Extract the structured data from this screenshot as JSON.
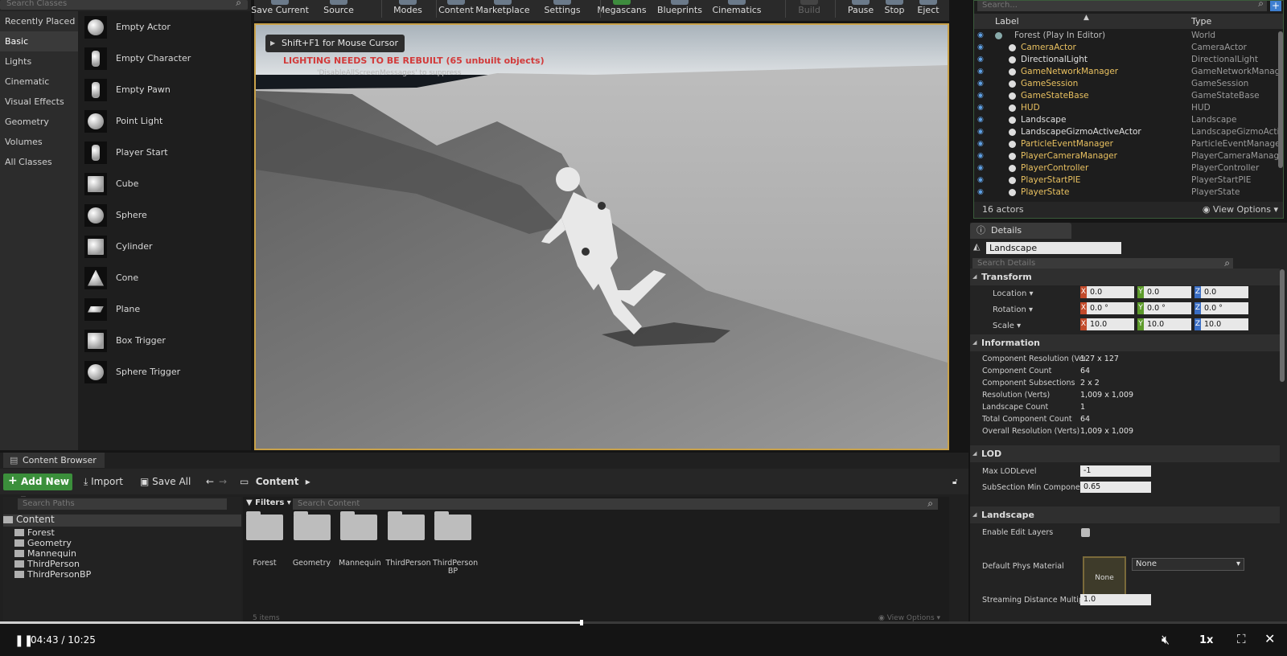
{
  "left_panel": {
    "search_placeholder": "Search Classes",
    "categories": [
      "Recently Placed",
      "Basic",
      "Lights",
      "Cinematic",
      "Visual Effects",
      "Geometry",
      "Volumes",
      "All Classes"
    ],
    "selected_category": "Basic",
    "classes": [
      {
        "label": "Empty Actor",
        "icon": "sphere-icon"
      },
      {
        "label": "Empty Character",
        "icon": "mannequin-icon"
      },
      {
        "label": "Empty Pawn",
        "icon": "pawn-icon"
      },
      {
        "label": "Point Light",
        "icon": "light-bulb-icon"
      },
      {
        "label": "Player Start",
        "icon": "player-start-icon"
      },
      {
        "label": "Cube",
        "icon": "cube-icon"
      },
      {
        "label": "Sphere",
        "icon": "sphere-icon"
      },
      {
        "label": "Cylinder",
        "icon": "cylinder-icon"
      },
      {
        "label": "Cone",
        "icon": "cone-icon"
      },
      {
        "label": "Plane",
        "icon": "plane-icon"
      },
      {
        "label": "Box Trigger",
        "icon": "box-trigger-icon"
      },
      {
        "label": "Sphere Trigger",
        "icon": "sphere-trigger-icon"
      }
    ]
  },
  "toolbar": {
    "buttons": [
      "Save Current",
      "Source Control",
      "Modes",
      "Content",
      "Marketplace",
      "Settings",
      "Megascans",
      "Blueprints",
      "Cinematics",
      "Build",
      "Pause",
      "Stop",
      "Eject"
    ]
  },
  "viewport": {
    "hint": "Shift+F1 for Mouse Cursor",
    "warning": "LIGHTING NEEDS TO BE REBUILT (65 unbuilt objects)",
    "dismiss": "'DisableAllScreenMessages' to suppress"
  },
  "outliner": {
    "search_placeholder": "Search...",
    "col_label": "Label",
    "col_type": "Type",
    "root": {
      "label": "Forest (Play In Editor)",
      "type": "World"
    },
    "rows": [
      {
        "label": "CameraActor",
        "type": "CameraActor",
        "highlight": true
      },
      {
        "label": "DirectionalLight",
        "type": "DirectionalLight",
        "highlight": false
      },
      {
        "label": "GameNetworkManager",
        "type": "GameNetworkManager",
        "highlight": true
      },
      {
        "label": "GameSession",
        "type": "GameSession",
        "highlight": true
      },
      {
        "label": "GameStateBase",
        "type": "GameStateBase",
        "highlight": true
      },
      {
        "label": "HUD",
        "type": "HUD",
        "highlight": true
      },
      {
        "label": "Landscape",
        "type": "Landscape",
        "highlight": false
      },
      {
        "label": "LandscapeGizmoActiveActor",
        "type": "LandscapeGizmoActiv",
        "highlight": false
      },
      {
        "label": "ParticleEventManager",
        "type": "ParticleEventManager",
        "highlight": true
      },
      {
        "label": "PlayerCameraManager",
        "type": "PlayerCameraManage",
        "highlight": true
      },
      {
        "label": "PlayerController",
        "type": "PlayerController",
        "highlight": true
      },
      {
        "label": "PlayerStartPIE",
        "type": "PlayerStartPIE",
        "highlight": true
      },
      {
        "label": "PlayerState",
        "type": "PlayerState",
        "highlight": true
      }
    ],
    "count": "16 actors",
    "view_options": "View Options"
  },
  "details": {
    "tab": "Details",
    "actor_name": "Landscape",
    "search_placeholder": "Search Details",
    "transform_title": "Transform",
    "location_label": "Location",
    "location": [
      "0.0",
      "0.0",
      "0.0"
    ],
    "rotation_label": "Rotation",
    "rotation": [
      "0.0 °",
      "0.0 °",
      "0.0 °"
    ],
    "scale_label": "Scale",
    "scale": [
      "10.0",
      "10.0",
      "10.0"
    ],
    "information_title": "Information",
    "information": [
      {
        "k": "Component Resolution (Vert",
        "v": "127 x 127"
      },
      {
        "k": "Component Count",
        "v": "64"
      },
      {
        "k": "Component Subsections",
        "v": "2 x 2"
      },
      {
        "k": "Resolution (Verts)",
        "v": "1,009 x 1,009"
      },
      {
        "k": "Landscape Count",
        "v": "1"
      },
      {
        "k": "Total Component Count",
        "v": "64"
      },
      {
        "k": "Overall Resolution (Verts)",
        "v": "1,009 x 1,009"
      }
    ],
    "lod_title": "LOD",
    "max_lod_label": "Max LODLevel",
    "max_lod_value": "-1",
    "subsection_label": "SubSection Min Component",
    "subsection_value": "0.65",
    "landscape_title": "Landscape",
    "edit_layers_label": "Enable Edit Layers",
    "phys_label": "Default Phys Material",
    "phys_thumb": "None",
    "phys_value": "None",
    "streaming_label": "Streaming Distance Multiplie",
    "streaming_value": "1.0"
  },
  "content_browser": {
    "tab": "Content Browser",
    "add_new": "Add New",
    "import": "Import",
    "save_all": "Save All",
    "crumb": "Content",
    "path_search_placeholder": "Search Paths",
    "tree_root": "Content",
    "tree": [
      "Forest",
      "Geometry",
      "Mannequin",
      "ThirdPerson",
      "ThirdPersonBP"
    ],
    "filters": "Filters",
    "content_search_placeholder": "Search Content",
    "folders": [
      "Forest",
      "Geometry",
      "Mannequin",
      "ThirdPerson",
      "ThirdPerson BP"
    ],
    "items_count": "5 items",
    "view_options": "View Options"
  },
  "player": {
    "time": "04:43 / 10:25",
    "speed": "1x",
    "progress": 0.452
  }
}
